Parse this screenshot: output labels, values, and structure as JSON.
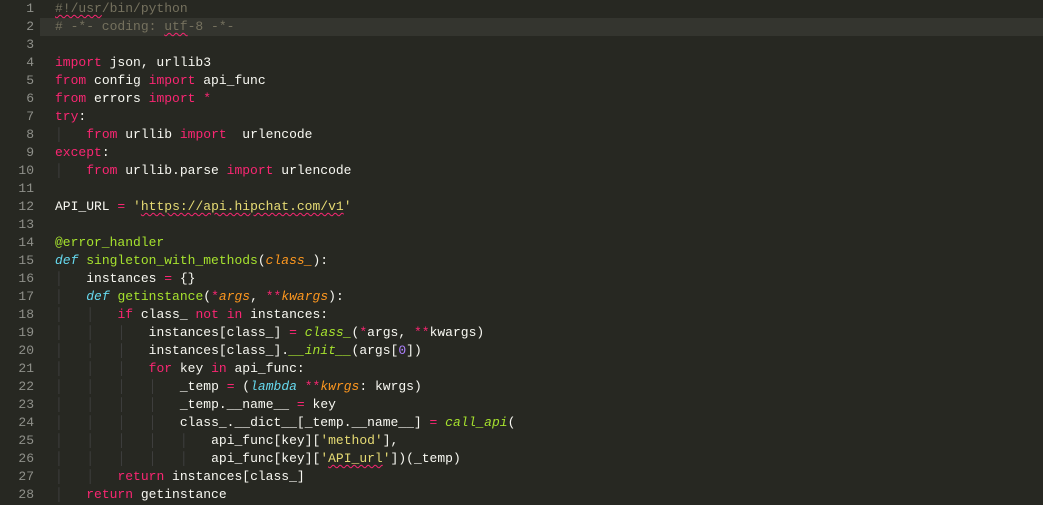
{
  "lines": [
    {
      "n": 1,
      "ind": 0,
      "tokens": [
        [
          "c-comment squiggle",
          "#!/usr"
        ],
        [
          "c-comment",
          "/bin/python"
        ]
      ]
    },
    {
      "n": 2,
      "ind": 0,
      "highlight": true,
      "tokens": [
        [
          "c-comment",
          "# -*- coding: "
        ],
        [
          "c-comment squiggle",
          "utf"
        ],
        [
          "c-comment",
          "-8 -*-"
        ]
      ]
    },
    {
      "n": 3,
      "ind": 0,
      "tokens": [
        [
          "c-default",
          ""
        ]
      ]
    },
    {
      "n": 4,
      "ind": 0,
      "tokens": [
        [
          "c-kw",
          "import"
        ],
        [
          "c-default",
          " json, urllib3"
        ]
      ]
    },
    {
      "n": 5,
      "ind": 0,
      "tokens": [
        [
          "c-kw",
          "from"
        ],
        [
          "c-default",
          " config "
        ],
        [
          "c-kw",
          "import"
        ],
        [
          "c-default",
          " api_func"
        ]
      ]
    },
    {
      "n": 6,
      "ind": 0,
      "tokens": [
        [
          "c-kw",
          "from"
        ],
        [
          "c-default",
          " errors "
        ],
        [
          "c-kw",
          "import"
        ],
        [
          "c-default",
          " "
        ],
        [
          "c-op",
          "*"
        ]
      ]
    },
    {
      "n": 7,
      "ind": 0,
      "tokens": [
        [
          "c-kw",
          "try"
        ],
        [
          "c-default",
          ":"
        ]
      ]
    },
    {
      "n": 8,
      "ind": 1,
      "tokens": [
        [
          "c-kw",
          "from"
        ],
        [
          "c-default",
          " urllib "
        ],
        [
          "c-kw",
          "import"
        ],
        [
          "c-default",
          "  urlencode"
        ]
      ]
    },
    {
      "n": 9,
      "ind": 0,
      "tokens": [
        [
          "c-kw",
          "except"
        ],
        [
          "c-default",
          ":"
        ]
      ]
    },
    {
      "n": 10,
      "ind": 1,
      "tokens": [
        [
          "c-kw",
          "from"
        ],
        [
          "c-default",
          " urllib.parse "
        ],
        [
          "c-kw",
          "import"
        ],
        [
          "c-default",
          " urlencode"
        ]
      ]
    },
    {
      "n": 11,
      "ind": 0,
      "tokens": [
        [
          "c-default",
          ""
        ]
      ]
    },
    {
      "n": 12,
      "ind": 0,
      "tokens": [
        [
          "c-default",
          "API_URL "
        ],
        [
          "c-op",
          "="
        ],
        [
          "c-default",
          " "
        ],
        [
          "c-str",
          "'"
        ],
        [
          "c-str squiggle",
          "https://api.hipchat.com/v1"
        ],
        [
          "c-str",
          "'"
        ]
      ]
    },
    {
      "n": 13,
      "ind": 0,
      "tokens": [
        [
          "c-default",
          ""
        ]
      ]
    },
    {
      "n": 14,
      "ind": 0,
      "tokens": [
        [
          "c-deco",
          "@error_handler"
        ]
      ]
    },
    {
      "n": 15,
      "ind": 0,
      "tokens": [
        [
          "c-builtin",
          "def"
        ],
        [
          "c-default",
          " "
        ],
        [
          "c-def",
          "singleton_with_methods"
        ],
        [
          "c-default",
          "("
        ],
        [
          "c-param",
          "class_"
        ],
        [
          "c-default",
          "):"
        ]
      ]
    },
    {
      "n": 16,
      "ind": 1,
      "tokens": [
        [
          "c-default",
          "instances "
        ],
        [
          "c-op",
          "="
        ],
        [
          "c-default",
          " {}"
        ]
      ]
    },
    {
      "n": 17,
      "ind": 1,
      "tokens": [
        [
          "c-builtin",
          "def"
        ],
        [
          "c-default",
          " "
        ],
        [
          "c-def",
          "getinstance"
        ],
        [
          "c-default",
          "("
        ],
        [
          "c-op",
          "*"
        ],
        [
          "c-param",
          "args"
        ],
        [
          "c-default",
          ", "
        ],
        [
          "c-op",
          "**"
        ],
        [
          "c-param",
          "kwargs"
        ],
        [
          "c-default",
          "):"
        ]
      ]
    },
    {
      "n": 18,
      "ind": 2,
      "tokens": [
        [
          "c-kw",
          "if"
        ],
        [
          "c-default",
          " class_ "
        ],
        [
          "c-kw",
          "not"
        ],
        [
          "c-default",
          " "
        ],
        [
          "c-kw",
          "in"
        ],
        [
          "c-default",
          " instances:"
        ]
      ]
    },
    {
      "n": 19,
      "ind": 3,
      "tokens": [
        [
          "c-default",
          "instances[class_] "
        ],
        [
          "c-op",
          "="
        ],
        [
          "c-default",
          " "
        ],
        [
          "c-def-ital",
          "class_"
        ],
        [
          "c-default",
          "("
        ],
        [
          "c-op",
          "*"
        ],
        [
          "c-default",
          "args, "
        ],
        [
          "c-op",
          "**"
        ],
        [
          "c-default",
          "kwargs)"
        ]
      ]
    },
    {
      "n": 20,
      "ind": 3,
      "tokens": [
        [
          "c-default",
          "instances[class_]."
        ],
        [
          "c-def-ital",
          "__init__"
        ],
        [
          "c-default",
          "(args["
        ],
        [
          "c-num",
          "0"
        ],
        [
          "c-default",
          "])"
        ]
      ]
    },
    {
      "n": 21,
      "ind": 3,
      "tokens": [
        [
          "c-kw",
          "for"
        ],
        [
          "c-default",
          " key "
        ],
        [
          "c-kw",
          "in"
        ],
        [
          "c-default",
          " api_func:"
        ]
      ]
    },
    {
      "n": 22,
      "ind": 4,
      "tokens": [
        [
          "c-default",
          "_temp "
        ],
        [
          "c-op",
          "="
        ],
        [
          "c-default",
          " ("
        ],
        [
          "c-builtin",
          "lambda"
        ],
        [
          "c-default",
          " "
        ],
        [
          "c-op",
          "**"
        ],
        [
          "c-param",
          "kwrgs"
        ],
        [
          "c-default",
          ": kwrgs)"
        ]
      ]
    },
    {
      "n": 23,
      "ind": 4,
      "tokens": [
        [
          "c-default",
          "_temp.__name__ "
        ],
        [
          "c-op",
          "="
        ],
        [
          "c-default",
          " key"
        ]
      ]
    },
    {
      "n": 24,
      "ind": 4,
      "tokens": [
        [
          "c-default",
          "class_.__dict__[_temp.__name__] "
        ],
        [
          "c-op",
          "="
        ],
        [
          "c-default",
          " "
        ],
        [
          "c-def-ital",
          "call_api"
        ],
        [
          "c-default",
          "("
        ]
      ]
    },
    {
      "n": 25,
      "ind": 5,
      "tokens": [
        [
          "c-default",
          "api_func[key]["
        ],
        [
          "c-str",
          "'method'"
        ],
        [
          "c-default",
          "],"
        ]
      ]
    },
    {
      "n": 26,
      "ind": 5,
      "tokens": [
        [
          "c-default",
          "api_func[key]["
        ],
        [
          "c-str",
          "'"
        ],
        [
          "c-str squiggle",
          "API_url"
        ],
        [
          "c-str",
          "'"
        ],
        [
          "c-default",
          "])(_temp)"
        ]
      ]
    },
    {
      "n": 27,
      "ind": 2,
      "tokens": [
        [
          "c-kw",
          "return"
        ],
        [
          "c-default",
          " instances[class_]"
        ]
      ]
    },
    {
      "n": 28,
      "ind": 1,
      "tokens": [
        [
          "c-kw",
          "return"
        ],
        [
          "c-default",
          " getinstance"
        ]
      ]
    }
  ],
  "indentUnit": "    "
}
